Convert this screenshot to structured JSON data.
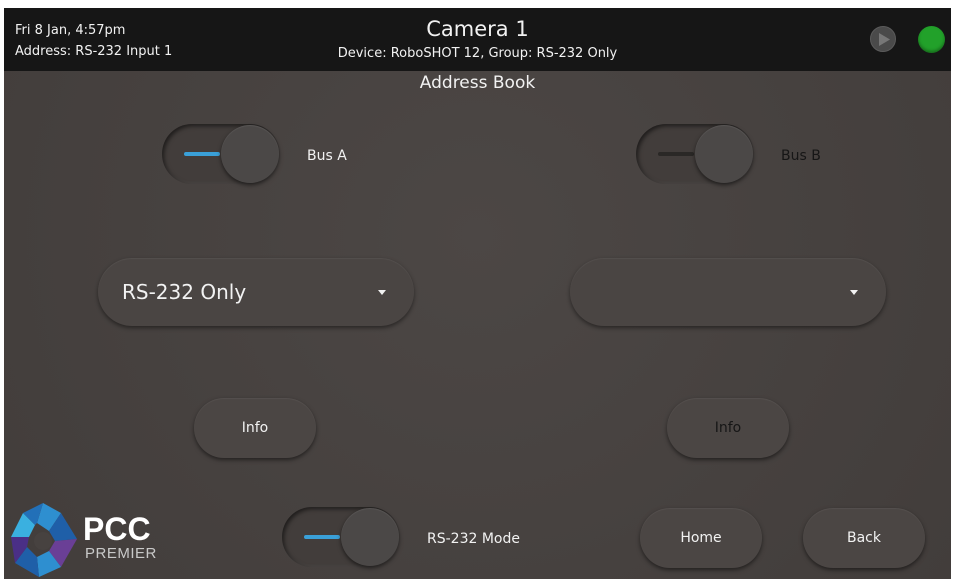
{
  "header": {
    "datetime": "Fri 8 Jan, 4:57pm",
    "address": "Address: RS-232 Input 1",
    "title": "Camera 1",
    "subtitle": "Device: RoboSHOT 12, Group: RS-232 Only",
    "play_icon": "play-icon",
    "status_color": "#22a12a"
  },
  "page": {
    "section_title": "Address Book"
  },
  "bus_a": {
    "label": "Bus A",
    "enabled": true,
    "group_selected": "RS-232 Only",
    "info_label": "Info"
  },
  "bus_b": {
    "label": "Bus B",
    "enabled": false,
    "group_selected": "",
    "info_label": "Info"
  },
  "footer": {
    "mode_label": "RS-232 Mode",
    "mode_enabled": true,
    "home_label": "Home",
    "back_label": "Back",
    "logo_text": "PCC",
    "logo_subtext": "PREMIER"
  },
  "colors": {
    "accent": "#3aa0d8",
    "topbar": "#161616",
    "background": "#474240",
    "status_ok": "#22a12a"
  }
}
